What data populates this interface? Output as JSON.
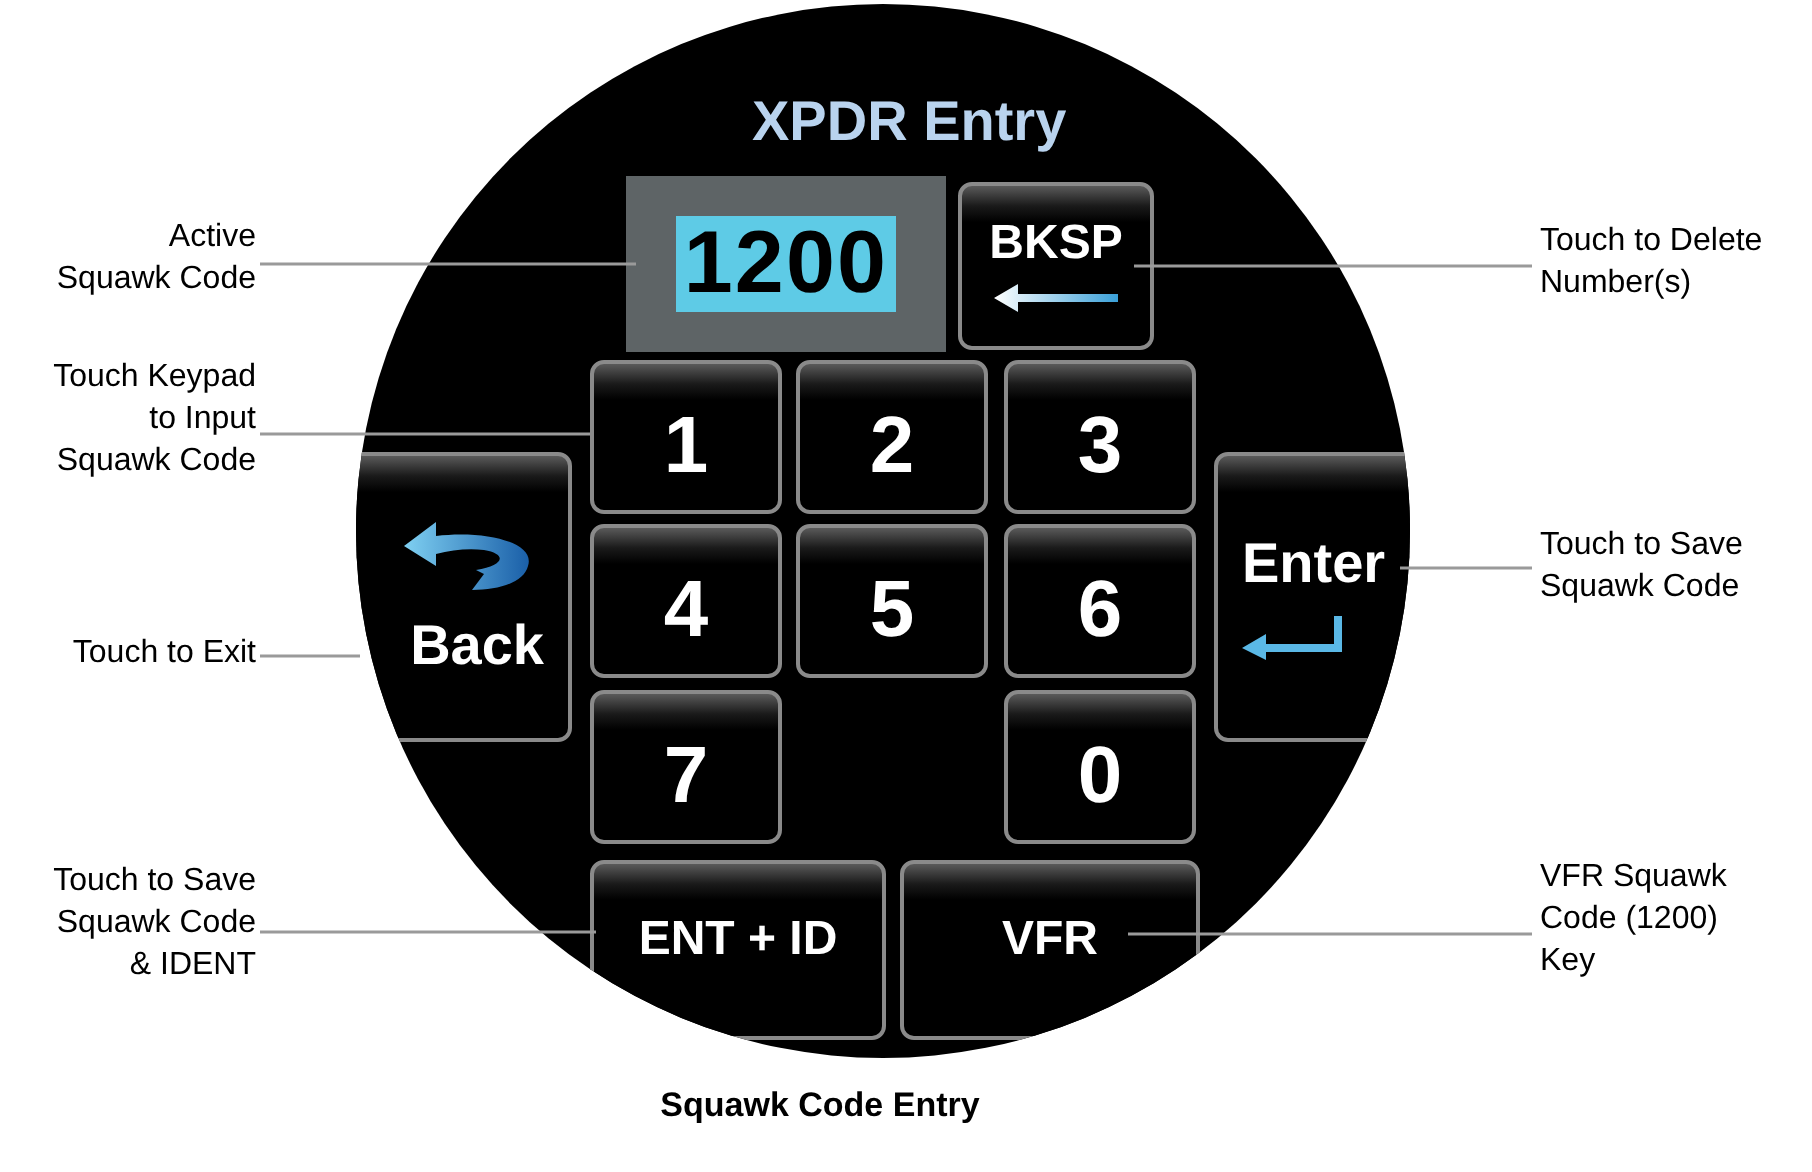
{
  "screen": {
    "title": "XPDR Entry",
    "code": {
      "value": "1200",
      "highlighted": true
    },
    "backspace": {
      "label": "BKSP"
    },
    "keys": [
      {
        "label": "1"
      },
      {
        "label": "2"
      },
      {
        "label": "3"
      },
      {
        "label": "4"
      },
      {
        "label": "5"
      },
      {
        "label": "6"
      },
      {
        "label": "7"
      },
      {
        "label": "0"
      }
    ],
    "back": {
      "label": "Back"
    },
    "enter": {
      "label": "Enter"
    },
    "bottom_buttons": [
      {
        "label": "ENT + ID"
      },
      {
        "label": "VFR"
      }
    ]
  },
  "callouts": [
    {
      "text": "Active\nSquawk Code"
    },
    {
      "text": "Touch Keypad\nto Input\nSquawk Code"
    },
    {
      "text": "Touch to Exit"
    },
    {
      "text": "Touch to Save\nSquawk Code\n& IDENT"
    },
    {
      "text": "Touch to Delete\nNumber(s)"
    },
    {
      "text": "Touch to Save\nSquawk Code"
    },
    {
      "text": "VFR Squawk\nCode (1200)\nKey"
    }
  ],
  "caption": "Squawk Code Entry"
}
